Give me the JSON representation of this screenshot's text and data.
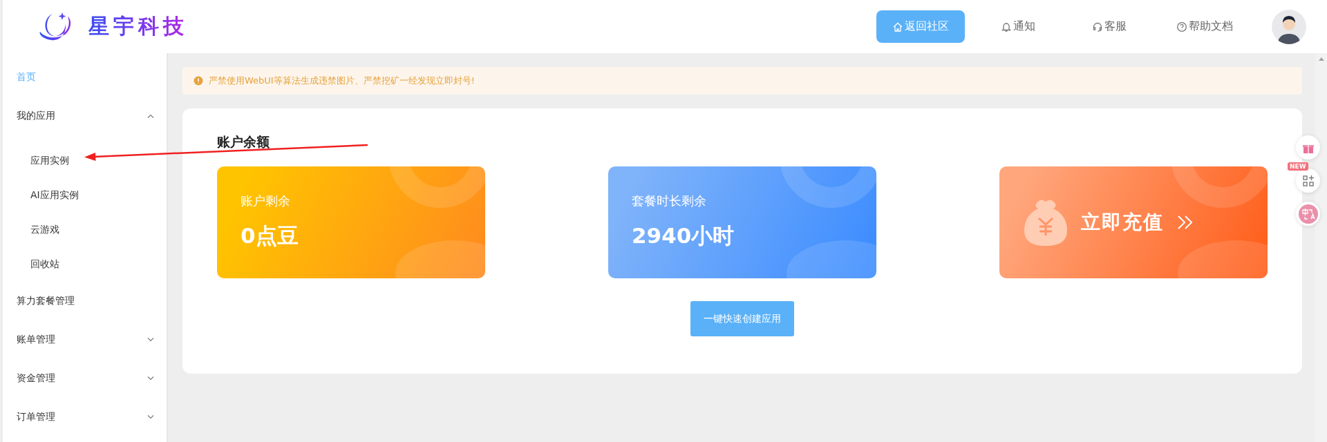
{
  "header": {
    "logo": "星宇科技",
    "nav": [
      {
        "label": "返回社区",
        "selected": true
      },
      {
        "label": "通知",
        "selected": false
      },
      {
        "label": "客服",
        "selected": false
      },
      {
        "label": "帮助文档",
        "selected": false
      }
    ]
  },
  "sidebar": {
    "items": [
      {
        "label": "首页",
        "kind": "link",
        "selected": true
      },
      {
        "label": "我的应用",
        "kind": "group",
        "selected": false,
        "expanded": true,
        "children": [
          {
            "label": "应用实例",
            "selected": false
          },
          {
            "label": "AI应用实例",
            "selected": false
          },
          {
            "label": "云游戏",
            "selected": false
          },
          {
            "label": "回收站",
            "selected": false
          }
        ]
      },
      {
        "label": "算力套餐管理",
        "kind": "link",
        "selected": false
      },
      {
        "label": "账单管理",
        "kind": "group",
        "selected": false,
        "expanded": false
      },
      {
        "label": "资金管理",
        "kind": "group",
        "selected": false,
        "expanded": false
      },
      {
        "label": "订单管理",
        "kind": "group",
        "selected": false,
        "expanded": false
      }
    ]
  },
  "notice": "严禁使用WebUI等算法生成违禁图片、严禁挖矿一经发现立即封号!",
  "balance": {
    "title": "账户余额",
    "cards": [
      {
        "kind": "balance",
        "label": "账户剩余",
        "value": "0点豆"
      },
      {
        "kind": "package",
        "label": "套餐时长剩余",
        "value": "2940小时"
      },
      {
        "kind": "recharge",
        "label": "立即充值"
      }
    ],
    "create_button": "一键快速创建应用"
  },
  "floating": {
    "badge": "NEW"
  }
}
